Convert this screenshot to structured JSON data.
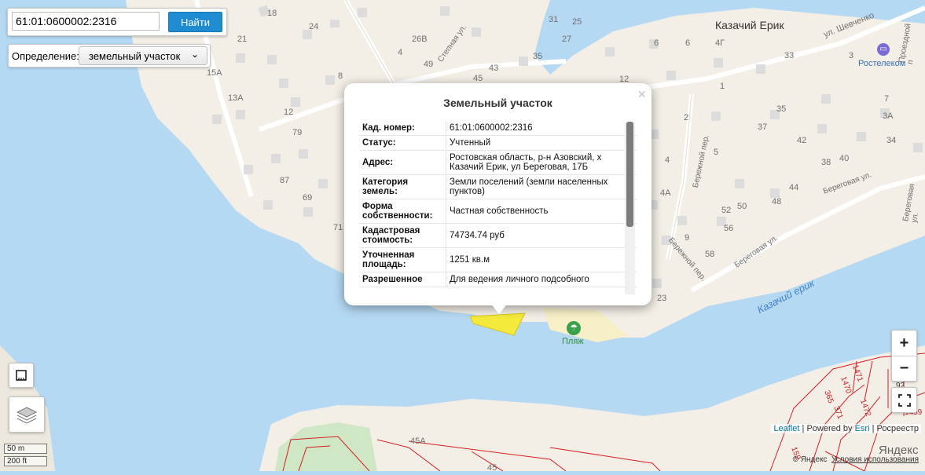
{
  "search": {
    "value": "61:01:0600002:2316",
    "button_label": "Найти"
  },
  "definition": {
    "label": "Определение:",
    "selected": "земельный участок"
  },
  "popup": {
    "title": "Земельный участок",
    "rows": [
      {
        "key": "Кад. номер",
        "suffix": ":",
        "value": "61:01:0600002:2316"
      },
      {
        "key": "Статус",
        "suffix": ":",
        "value": "Учтенный"
      },
      {
        "key": "Адрес",
        "suffix": ":",
        "value": "Ростовская область, р-н Азовский, х Казачий Ерик, ул Береговая, 17Б"
      },
      {
        "key": "Категория земель",
        "suffix": ":",
        "value": "Земли поселений (земли населенных пунктов)"
      },
      {
        "key": "Форма собственности",
        "suffix": ":",
        "value": "Частная собственность"
      },
      {
        "key": "Кадастровая стоимость",
        "suffix": ":",
        "value": "74734.74 руб"
      },
      {
        "key": "Уточненная площадь",
        "suffix": ":",
        "value": "1251 кв.м"
      },
      {
        "key": "Разрешенное",
        "suffix": "",
        "value": "Для ведения личного подсобного"
      }
    ]
  },
  "map": {
    "place_name": "Казачий Ерик",
    "poi_rostelecom": "Ростелеком",
    "poi_beach": "Пляж",
    "river_label": "Казачий ерик",
    "streets": [
      "Степная ул.",
      "ул. Шевченко",
      "Проездной п",
      "Бережной пер.",
      "Береговая ул.",
      "Береговая ул.",
      "Бережной пер.",
      "Береговая ул."
    ],
    "house_numbers": [
      "18",
      "24",
      "21",
      "26В",
      "31",
      "25",
      "27",
      "15А",
      "8",
      "4",
      "49",
      "43",
      "45",
      "35",
      "13А",
      "12",
      "79",
      "6",
      "6",
      "4Г",
      "1",
      "33",
      "3",
      "12",
      "7",
      "2",
      "35",
      "37",
      "3А",
      "42",
      "34",
      "5",
      "40",
      "38",
      "4",
      "44",
      "87",
      "69",
      "71",
      "4А",
      "52",
      "50",
      "48",
      "56",
      "9",
      "58",
      "23",
      "45А",
      "45",
      "92"
    ],
    "cadastre_numbers": [
      "1470",
      "1471",
      "1472",
      "1459",
      "365",
      "371",
      "159"
    ],
    "yandex_logo": "Яндекс"
  },
  "zoom": {
    "in": "+",
    "out": "−"
  },
  "scale": {
    "metric": "50 m",
    "imperial": "200 ft"
  },
  "attribution": {
    "leaflet": "Leaflet",
    "sep1": " | Powered by ",
    "esri": "Esri",
    "sep2": " | Росреестр"
  },
  "copyright": {
    "text": "© Яндекс",
    "terms": "Условия использования"
  },
  "colors": {
    "water": "#b5d9f3",
    "land": "#f3efe6",
    "building": "#dddddd",
    "cadastre": "#d51f26",
    "parcel_highlight": "#f4ea3b",
    "button": "#1f8bd0"
  }
}
